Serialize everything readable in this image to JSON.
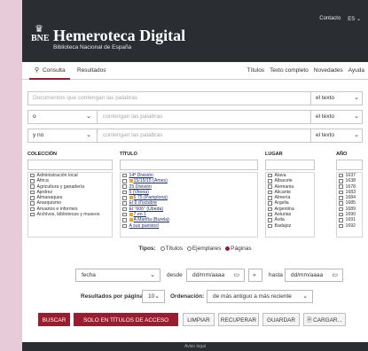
{
  "header": {
    "contact": "Contacto",
    "lang": "ES",
    "logo_crown": "♛",
    "logo_text": "BNE",
    "title": "Hemeroteca Digital",
    "subtitle": "Biblioteca Nacional de España"
  },
  "nav": {
    "tabs": [
      {
        "label": "Consulta",
        "active": true
      },
      {
        "label": "Resultados",
        "active": false
      }
    ],
    "links": [
      "Títulos",
      "Texto completo",
      "Novedades",
      "Ayuda"
    ]
  },
  "search": {
    "row1": {
      "placeholder": "Documentos que contengan las palabras",
      "field": "el texto"
    },
    "row2": {
      "operator": "o",
      "placeholder": "contengan las palabras",
      "field": "el texto"
    },
    "row3": {
      "operator": "y no",
      "placeholder": "contengan las palabras",
      "field": "el texto"
    }
  },
  "facets": {
    "coleccion": {
      "label": "COLECCIÓN",
      "items": [
        "Administración local",
        "África",
        "Agricultura y ganadería",
        "Ajedrez",
        "Almanaques",
        "Anarquismo",
        "Anuarios e informes",
        "Archivos, bibliotecas y museos"
      ]
    },
    "titulo": {
      "label": "TÍTULO",
      "items": [
        {
          "text": "14ª División",
          "marked": false
        },
        {
          "text": "15/15/15 (Ames)",
          "marked": true
        },
        {
          "text": "25 División",
          "marked": false
        },
        {
          "text": "5 (Vitoria)",
          "marked": false
        },
        {
          "text": "6 75 (Pamplona)",
          "marked": true
        },
        {
          "text": "El 6 d'octubre",
          "marked": false
        },
        {
          "text": "El \"606\" (Úbeda)",
          "marked": false
        },
        {
          "text": "7 en 1",
          "marked": true
        },
        {
          "text": "A Mariña (Burela)",
          "marked": true
        },
        {
          "text": "A sus puestos!",
          "marked": false
        }
      ]
    },
    "lugar": {
      "label": "LUGAR",
      "items": [
        "Álava",
        "Albacete",
        "Alemania",
        "Alicante",
        "Almería",
        "Argelia",
        "Argentina",
        "Asturias",
        "Ávila",
        "Badajoz"
      ]
    },
    "ano": {
      "label": "AÑO",
      "items": [
        "1637",
        "1638",
        "1678",
        "1683",
        "1684",
        "1685",
        "1689",
        "1690",
        "1691",
        "1692"
      ]
    }
  },
  "tipos": {
    "label": "Tipos:",
    "options": [
      {
        "label": "Títulos",
        "selected": false
      },
      {
        "label": "Ejemplares",
        "selected": false
      },
      {
        "label": "Páginas",
        "selected": true
      }
    ]
  },
  "dates": {
    "field": "fecha",
    "desde_label": "desde",
    "desde_value": "dd/mm/aaaa",
    "swap": "»",
    "hasta_label": "hasta",
    "hasta_value": "dd/mm/aaaa",
    "calendar_icon": "calendar-icon"
  },
  "results": {
    "per_page_label": "Resultados por página:",
    "per_page_value": "10",
    "order_label": "Ordenación:",
    "order_value": "de más antiguo a más reciente"
  },
  "buttons": {
    "buscar": "BUSCAR",
    "acceso_libre": "SOLO EN TÍTULOS DE ACCESO LIBRE",
    "limpiar": "LIMPIAR",
    "recuperar": "RECUPERAR",
    "guardar": "GUARDAR",
    "cargar": "CARGAR..."
  },
  "footer": {
    "text": "Aviso legal"
  },
  "colors": {
    "accent": "#9b1c2e",
    "header_bg": "#2a2e33",
    "link": "#1f2e77"
  }
}
